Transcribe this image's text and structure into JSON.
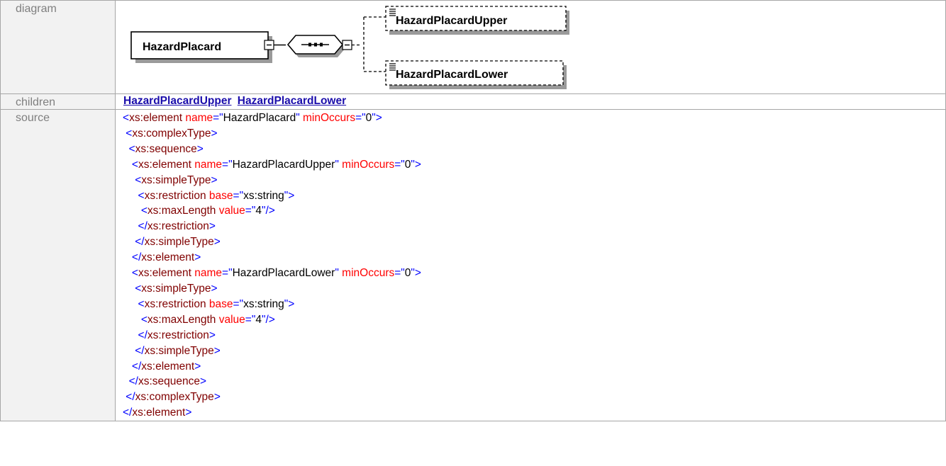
{
  "rows": {
    "diagram": {
      "label": "diagram",
      "root_element": "HazardPlacard",
      "child_elements": [
        "HazardPlacardUpper",
        "HazardPlacardLower"
      ]
    },
    "children": {
      "label": "children",
      "links": [
        "HazardPlacardUpper",
        "HazardPlacardLower"
      ]
    },
    "source": {
      "label": "source",
      "lines": [
        [
          {
            "t": "tag",
            "v": "<"
          },
          {
            "t": "nm",
            "v": "xs:element"
          },
          {
            "t": "attr",
            "v": " name"
          },
          {
            "t": "tag",
            "v": "=\""
          },
          {
            "t": "val",
            "v": "HazardPlacard"
          },
          {
            "t": "tag",
            "v": "\""
          },
          {
            "t": "attr",
            "v": " minOccurs"
          },
          {
            "t": "tag",
            "v": "=\""
          },
          {
            "t": "val",
            "v": "0"
          },
          {
            "t": "tag",
            "v": "\">"
          }
        ],
        [
          {
            "t": "tag",
            "v": " <"
          },
          {
            "t": "nm",
            "v": "xs:complexType"
          },
          {
            "t": "tag",
            "v": ">"
          }
        ],
        [
          {
            "t": "tag",
            "v": "  <"
          },
          {
            "t": "nm",
            "v": "xs:sequence"
          },
          {
            "t": "tag",
            "v": ">"
          }
        ],
        [
          {
            "t": "tag",
            "v": "   <"
          },
          {
            "t": "nm",
            "v": "xs:element"
          },
          {
            "t": "attr",
            "v": " name"
          },
          {
            "t": "tag",
            "v": "=\""
          },
          {
            "t": "val",
            "v": "HazardPlacardUpper"
          },
          {
            "t": "tag",
            "v": "\""
          },
          {
            "t": "attr",
            "v": " minOccurs"
          },
          {
            "t": "tag",
            "v": "=\""
          },
          {
            "t": "val",
            "v": "0"
          },
          {
            "t": "tag",
            "v": "\">"
          }
        ],
        [
          {
            "t": "tag",
            "v": "    <"
          },
          {
            "t": "nm",
            "v": "xs:simpleType"
          },
          {
            "t": "tag",
            "v": ">"
          }
        ],
        [
          {
            "t": "tag",
            "v": "     <"
          },
          {
            "t": "nm",
            "v": "xs:restriction"
          },
          {
            "t": "attr",
            "v": " base"
          },
          {
            "t": "tag",
            "v": "=\""
          },
          {
            "t": "val",
            "v": "xs:string"
          },
          {
            "t": "tag",
            "v": "\">"
          }
        ],
        [
          {
            "t": "tag",
            "v": "      <"
          },
          {
            "t": "nm",
            "v": "xs:maxLength"
          },
          {
            "t": "attr",
            "v": " value"
          },
          {
            "t": "tag",
            "v": "=\""
          },
          {
            "t": "val",
            "v": "4"
          },
          {
            "t": "tag",
            "v": "\"/>"
          }
        ],
        [
          {
            "t": "tag",
            "v": "     </"
          },
          {
            "t": "nm",
            "v": "xs:restriction"
          },
          {
            "t": "tag",
            "v": ">"
          }
        ],
        [
          {
            "t": "tag",
            "v": "    </"
          },
          {
            "t": "nm",
            "v": "xs:simpleType"
          },
          {
            "t": "tag",
            "v": ">"
          }
        ],
        [
          {
            "t": "tag",
            "v": "   </"
          },
          {
            "t": "nm",
            "v": "xs:element"
          },
          {
            "t": "tag",
            "v": ">"
          }
        ],
        [
          {
            "t": "tag",
            "v": "   <"
          },
          {
            "t": "nm",
            "v": "xs:element"
          },
          {
            "t": "attr",
            "v": " name"
          },
          {
            "t": "tag",
            "v": "=\""
          },
          {
            "t": "val",
            "v": "HazardPlacardLower"
          },
          {
            "t": "tag",
            "v": "\""
          },
          {
            "t": "attr",
            "v": " minOccurs"
          },
          {
            "t": "tag",
            "v": "=\""
          },
          {
            "t": "val",
            "v": "0"
          },
          {
            "t": "tag",
            "v": "\">"
          }
        ],
        [
          {
            "t": "tag",
            "v": "    <"
          },
          {
            "t": "nm",
            "v": "xs:simpleType"
          },
          {
            "t": "tag",
            "v": ">"
          }
        ],
        [
          {
            "t": "tag",
            "v": "     <"
          },
          {
            "t": "nm",
            "v": "xs:restriction"
          },
          {
            "t": "attr",
            "v": " base"
          },
          {
            "t": "tag",
            "v": "=\""
          },
          {
            "t": "val",
            "v": "xs:string"
          },
          {
            "t": "tag",
            "v": "\">"
          }
        ],
        [
          {
            "t": "tag",
            "v": "      <"
          },
          {
            "t": "nm",
            "v": "xs:maxLength"
          },
          {
            "t": "attr",
            "v": " value"
          },
          {
            "t": "tag",
            "v": "=\""
          },
          {
            "t": "val",
            "v": "4"
          },
          {
            "t": "tag",
            "v": "\"/>"
          }
        ],
        [
          {
            "t": "tag",
            "v": "     </"
          },
          {
            "t": "nm",
            "v": "xs:restriction"
          },
          {
            "t": "tag",
            "v": ">"
          }
        ],
        [
          {
            "t": "tag",
            "v": "    </"
          },
          {
            "t": "nm",
            "v": "xs:simpleType"
          },
          {
            "t": "tag",
            "v": ">"
          }
        ],
        [
          {
            "t": "tag",
            "v": "   </"
          },
          {
            "t": "nm",
            "v": "xs:element"
          },
          {
            "t": "tag",
            "v": ">"
          }
        ],
        [
          {
            "t": "tag",
            "v": "  </"
          },
          {
            "t": "nm",
            "v": "xs:sequence"
          },
          {
            "t": "tag",
            "v": ">"
          }
        ],
        [
          {
            "t": "tag",
            "v": " </"
          },
          {
            "t": "nm",
            "v": "xs:complexType"
          },
          {
            "t": "tag",
            "v": ">"
          }
        ],
        [
          {
            "t": "tag",
            "v": "</"
          },
          {
            "t": "nm",
            "v": "xs:element"
          },
          {
            "t": "tag",
            "v": ">"
          }
        ]
      ]
    }
  },
  "colors": {
    "tag": "#0000ff",
    "element_name": "#800000",
    "attribute": "#ff0000",
    "value": "#000000",
    "link": "#1a0dab",
    "label_bg": "#f2f2f2",
    "label_text": "#7f7f7f",
    "border": "#a6a6a6",
    "shadow": "#9a9a9a"
  }
}
